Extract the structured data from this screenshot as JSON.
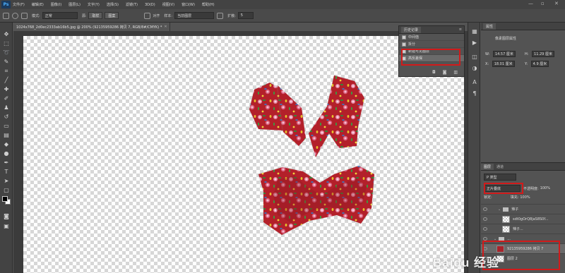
{
  "app": {
    "logo": "Ps"
  },
  "menubar": {
    "items": [
      "文件(F)",
      "编辑(E)",
      "图像(I)",
      "图层(L)",
      "文字(Y)",
      "选择(S)",
      "滤镜(T)",
      "3D(D)",
      "视图(V)",
      "窗口(W)",
      "帮助(H)"
    ],
    "minimize": "—",
    "restore": "▫",
    "close": "✕"
  },
  "options": {
    "mode_label": "模式:",
    "mode_value": "正常",
    "source_label": "源:",
    "source_btn1": "取样",
    "source_btn2": "图案",
    "align_label": "对齐",
    "sample_label": "样本:",
    "sample_value": "当前图层",
    "spread_label": "扩散:",
    "spread_value": "5"
  },
  "document": {
    "tab_title": "1024x768_2d0ec2333ab16b5.jpg @ 200% (92135959286 拷贝 7, RGB/8#/CMYK) *",
    "close": "✕"
  },
  "history": {
    "tab": "历史记录",
    "menu": "≡",
    "items": [
      "中间值",
      "拆分",
      "新建可见图层",
      "高反差保"
    ],
    "footer_icons": "◘ ◙ ▥"
  },
  "properties": {
    "tab": "属性",
    "title": "像素图层属性",
    "w_label": "W:",
    "w_value": "14.57 厘米",
    "h_label": "H:",
    "h_value": "11.29 厘米",
    "x_label": "X:",
    "x_value": "18.01 厘米",
    "y_label": "Y:",
    "y_value": "4.9 厘米"
  },
  "layers": {
    "tabs": [
      "图层",
      "通道"
    ],
    "kind_label": "P 类型",
    "blend_value": "正片叠底",
    "opacity_label": "不透明度:",
    "opacity_value": "100%",
    "lock_label": "锁定:",
    "fill_label": "填充:",
    "fill_value": "100%",
    "items": [
      {
        "name": "辣子",
        "kind": "group"
      },
      {
        "name": "sdt0gOrQ8jaS8S0f...",
        "kind": "layer"
      },
      {
        "name": "辣子...",
        "kind": "layer"
      },
      {
        "name": "...",
        "kind": "group"
      },
      {
        "name": "92135959286 拷贝 7",
        "kind": "layer-red"
      },
      {
        "name": "图层 2",
        "kind": "layer"
      }
    ]
  },
  "watermark": {
    "text": "Baidu 经验"
  },
  "colors": {
    "highlight": "#d21a1a",
    "fabric_red": "#b3202a"
  }
}
